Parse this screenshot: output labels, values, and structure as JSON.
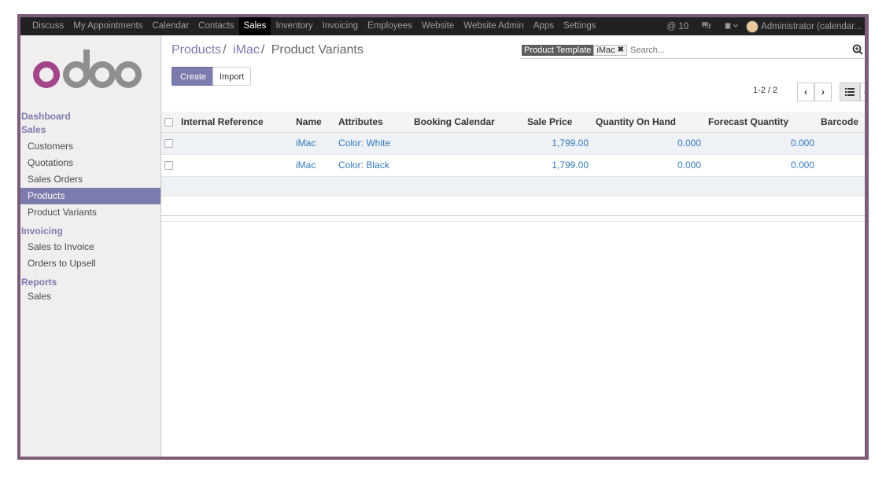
{
  "topbar": {
    "menu": [
      "Discuss",
      "My Appointments",
      "Calendar",
      "Contacts",
      "Sales",
      "Inventory",
      "Invoicing",
      "Employees",
      "Website",
      "Website Admin",
      "Apps",
      "Settings"
    ],
    "active_menu": "Sales",
    "notifications": "@ 10",
    "user": "Administrator (calendar..."
  },
  "sidebar": {
    "sections": [
      {
        "title": "Dashboard",
        "items": []
      },
      {
        "title": "Sales",
        "items": [
          "Customers",
          "Quotations",
          "Sales Orders",
          "Products",
          "Product Variants"
        ]
      },
      {
        "title": "Invoicing",
        "items": [
          "Sales to Invoice",
          "Orders to Upsell"
        ]
      },
      {
        "title": "Reports",
        "items": [
          "Sales"
        ]
      }
    ],
    "active_item": "Products"
  },
  "breadcrumb": {
    "b1": "Products",
    "b2": "iMac",
    "current": "Product Variants",
    "sep": "/"
  },
  "buttons": {
    "create": "Create",
    "import": "Import"
  },
  "search": {
    "facet_category": "Product Template",
    "facet_value": "iMac",
    "placeholder": "Search..."
  },
  "pager": {
    "text": "1-2 / 2"
  },
  "table": {
    "columns": [
      "Internal Reference",
      "Name",
      "Attributes",
      "Booking Calendar",
      "Sale Price",
      "Quantity On Hand",
      "Forecast Quantity",
      "Barcode"
    ],
    "rows": [
      {
        "ref": "",
        "name": "iMac",
        "attributes": "Color: White",
        "booking": "",
        "price": "1,799.00",
        "qty": "0.000",
        "forecast": "0.000",
        "barcode": ""
      },
      {
        "ref": "",
        "name": "iMac",
        "attributes": "Color: Black",
        "booking": "",
        "price": "1,799.00",
        "qty": "0.000",
        "forecast": "0.000",
        "barcode": ""
      }
    ]
  },
  "colors": {
    "brand": "#7c7bad",
    "frame": "#7c5c78",
    "topbar": "#212121",
    "link": "#337ab7"
  }
}
